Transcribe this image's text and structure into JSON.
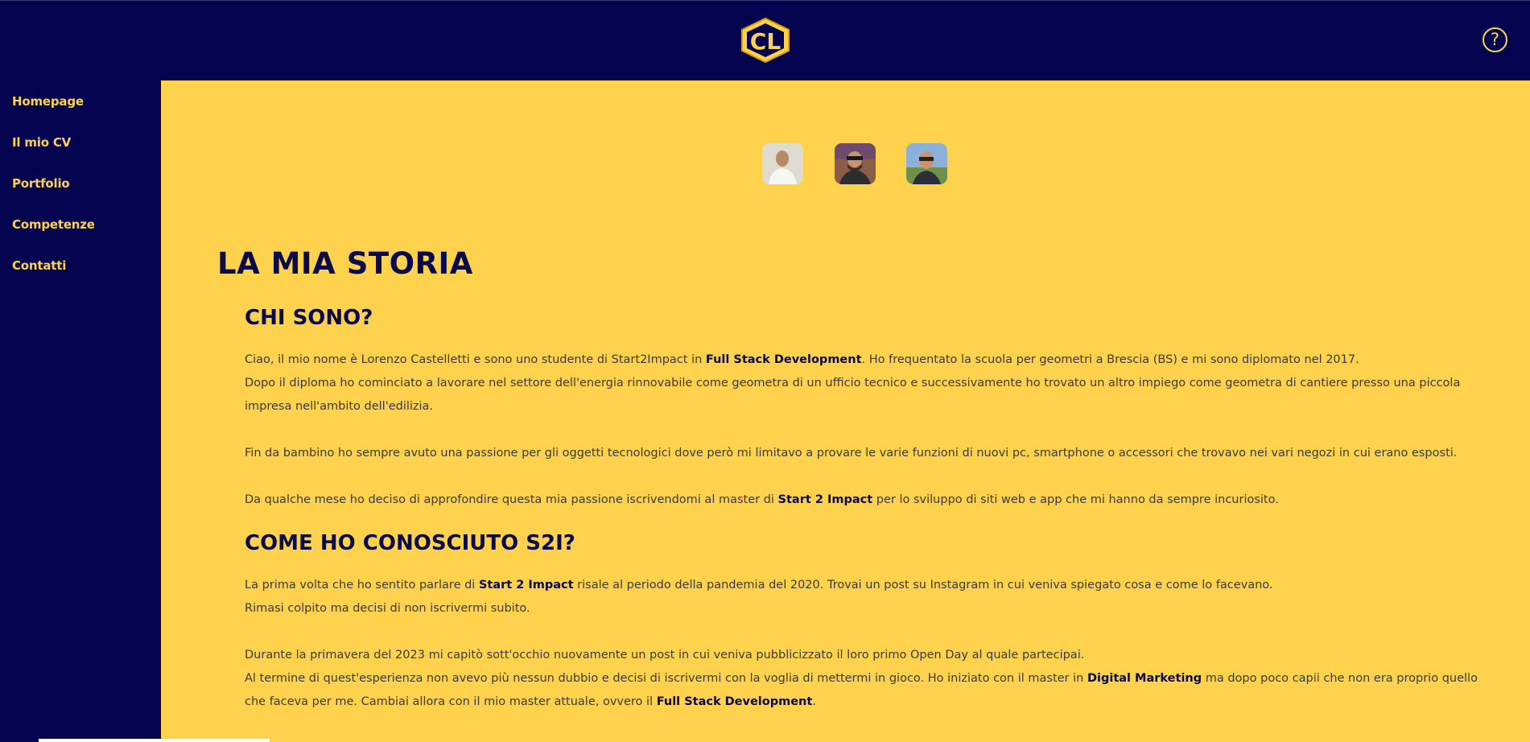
{
  "header": {
    "logo_text": "CL",
    "help_icon": "question-circle-icon"
  },
  "sidebar": {
    "items": [
      {
        "label": "Homepage"
      },
      {
        "label": "Il mio CV"
      },
      {
        "label": "Portfolio"
      },
      {
        "label": "Competenze"
      },
      {
        "label": "Contatti"
      }
    ]
  },
  "colors": {
    "navy": "#03034f",
    "yellow": "#ffd24d",
    "heading": "#0a0a48",
    "text": "#3d3a3a"
  },
  "main": {
    "title": "LA MIA STORIA",
    "section1": {
      "heading": "CHI SONO?",
      "p1": {
        "a": "Ciao, il mio nome è Lorenzo Castelletti e sono uno studente di Start2Impact in ",
        "b": "Full Stack Development",
        "c": ". Ho frequentato la scuola per geometri a Brescia (BS) e mi sono diplomato nel 2017.",
        "d": "Dopo il diploma ho cominciato a lavorare nel settore dell'energia rinnovabile come geometra di un ufficio tecnico e successivamente ho trovato un altro impiego come geometra di cantiere presso una piccola impresa nell'ambito dell'edilizia."
      },
      "p2": "Fin da bambino ho sempre avuto una passione per gli oggetti tecnologici dove però mi limitavo a provare le varie funzioni di nuovi pc, smartphone o accessori che trovavo nei vari negozi in cui erano esposti.",
      "p3": {
        "a": "Da qualche mese ho deciso di approfondire questa mia passione iscrivendomi al master di ",
        "b": "Start 2 Impact",
        "c": " per lo sviluppo di siti web e app che mi hanno da sempre incuriosito."
      }
    },
    "section2": {
      "heading": "COME HO CONOSCIUTO S2I?",
      "p1": {
        "a": "La prima volta che ho sentito parlare di ",
        "b": "Start 2 Impact",
        "c": " risale al periodo della pandemia del 2020. Trovai un post su Instagram in cui veniva spiegato cosa e come lo facevano.",
        "d": "Rimasi colpito ma decisi di non iscrivermi subito."
      },
      "p2": {
        "a": "Durante la primavera del 2023 mi capitò sott'occhio nuovamente un post in cui veniva pubblicizzato il loro primo Open Day al quale partecipai.",
        "b": "Al termine di quest'esperienza non avevo più nessun dubbio e decisi di iscrivermi con la voglia di mettermi in gioco. Ho iniziato con il master in ",
        "c": "Digital Marketing",
        "d": " ma dopo poco capii che non era proprio quello che faceva per me. Cambiai allora con il mio master attuale, ovvero il ",
        "e": "Full Stack Development",
        "f": "."
      }
    }
  }
}
